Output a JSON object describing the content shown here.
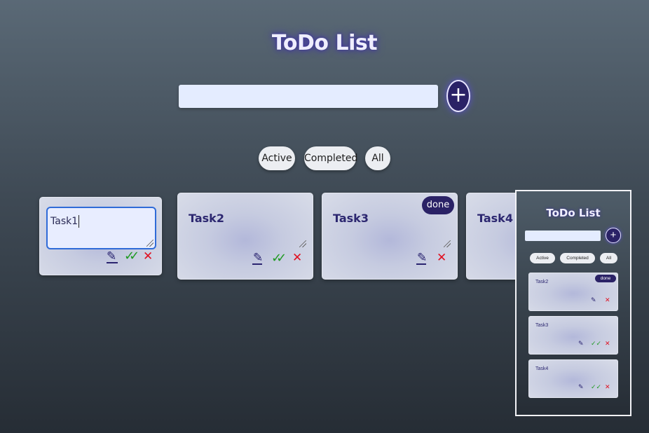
{
  "app": {
    "title": "ToDo List",
    "add_button_label": "+"
  },
  "input": {
    "value": "",
    "placeholder": ""
  },
  "filters": [
    {
      "label": "Active"
    },
    {
      "label": "Completed"
    },
    {
      "label": "All"
    }
  ],
  "tasks": [
    {
      "label": "Task1",
      "editing": true,
      "done": false
    },
    {
      "label": "Task2",
      "editing": false,
      "done": false
    },
    {
      "label": "Task3",
      "editing": false,
      "done": true,
      "badge": "done"
    },
    {
      "label": "Task4",
      "editing": false,
      "done": false
    }
  ],
  "preview": {
    "title": "ToDo List",
    "add_button_label": "+",
    "filters": [
      {
        "label": "Active"
      },
      {
        "label": "Completed"
      },
      {
        "label": "All"
      }
    ],
    "tasks": [
      {
        "label": "Task2",
        "badge": "done"
      },
      {
        "label": "Task3"
      },
      {
        "label": "Task4"
      }
    ]
  },
  "icons": {
    "edit": "pencil-icon",
    "complete": "double-check-icon",
    "delete": "cross-icon",
    "add": "plus-icon",
    "resize": "resize-grip-icon"
  },
  "colors": {
    "accent": "#2a2266",
    "input_bg": "#e4ecff",
    "check": "#1f9a22",
    "cross": "#e01020",
    "task_text": "#2c2770"
  }
}
